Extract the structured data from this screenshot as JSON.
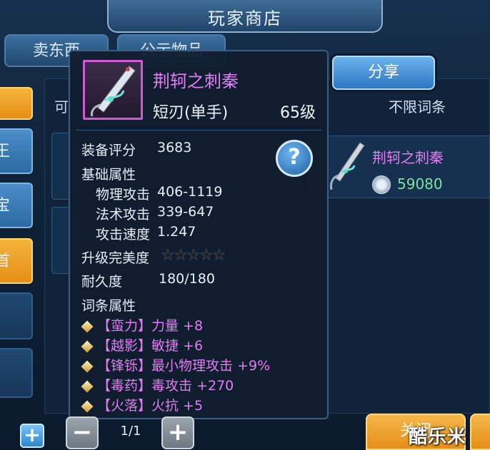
{
  "window": {
    "title": "玩家商店"
  },
  "tabs": [
    {
      "label": "卖东西"
    },
    {
      "label": "公示物品"
    }
  ],
  "sidebar": {
    "labels": [
      "王",
      "宝",
      "首"
    ]
  },
  "list": {
    "header_left": "可",
    "header_right": "不限词条",
    "items": [
      {
        "name": "荆轲之刺秦",
        "price": "59080"
      }
    ]
  },
  "share_label": "分享",
  "tooltip": {
    "name": "荆轲之刺秦",
    "type": "短刃(单手)",
    "level": "65级",
    "score_label": "装备评分",
    "score": "3683",
    "base_header": "基础属性",
    "base_stats": [
      {
        "label": "物理攻击",
        "value": "406-1119"
      },
      {
        "label": "法术攻击",
        "value": "339-647"
      },
      {
        "label": "攻击速度",
        "value": "1.247"
      }
    ],
    "perfection_label": "升级完美度",
    "perfection_stars": 0,
    "perfection_max": 5,
    "durability_label": "耐久度",
    "durability": "180/180",
    "mods_header": "词条属性",
    "mods": [
      {
        "tag": "【蛮力】",
        "text": "力量 +8"
      },
      {
        "tag": "【越影】",
        "text": "敏捷 +6"
      },
      {
        "tag": "【锋铄】",
        "text": "最小物理攻击 +9%"
      },
      {
        "tag": "【毒药】",
        "text": "毒攻击 +270"
      },
      {
        "tag": "【火落】",
        "text": "火抗 +5"
      }
    ],
    "help_symbol": "?"
  },
  "pager": {
    "minus": "−",
    "plus": "+",
    "page": "1/1"
  },
  "bottom": {
    "add_symbol": "+",
    "close_label": "关闭"
  },
  "watermark": "酷乐米",
  "colors": {
    "accent_pink": "#e27df0",
    "price_green": "#7ee0a1",
    "orange": "#f0a52c",
    "blue": "#2c77c4"
  }
}
